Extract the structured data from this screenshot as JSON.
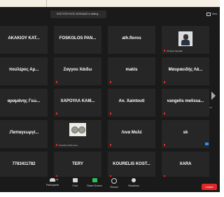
{
  "speaker": "ΚΩΣΤΟΠΟΥΛΟΣ ΛΕΩΝΙΔΑΣ is talking...",
  "view_label": "View",
  "tiles": [
    {
      "name": "ΑΚΑΚΙΟΥ ΚΑΤ...",
      "tag": ""
    },
    {
      "name": "FOSKOLOS PAN...",
      "tag": ""
    },
    {
      "name": "ath.floros",
      "tag": ""
    },
    {
      "name": "",
      "tag": "Christos Sanidas"
    },
    {
      "name": "πουλέρος Αρ...",
      "tag": ""
    },
    {
      "name": "Ζαγγου Χάιδω",
      "tag": ""
    },
    {
      "name": "makis",
      "tag": ""
    },
    {
      "name": "Μαυραειδής Λά...",
      "tag": ""
    },
    {
      "name": "αραμάνης Γεώ...",
      "tag": ""
    },
    {
      "name": "ΧΑΡΟΥΛΑ ΚΑΜ...",
      "tag": ""
    },
    {
      "name": "An. Xaintouti",
      "tag": ""
    },
    {
      "name": "vangelis melissa...",
      "tag": ""
    },
    {
      "name": ".Παπαγεωργί...",
      "tag": ""
    },
    {
      "name": "",
      "tag": "Κανελλή Χάιδω Ανα..."
    },
    {
      "name": "Λινα Μολέ",
      "tag": ""
    },
    {
      "name": "sk",
      "tag": ""
    },
    {
      "name": "7783411782",
      "tag": ""
    },
    {
      "name": "TERY",
      "tag": ""
    },
    {
      "name": "KOURELIS KOST...",
      "tag": ""
    },
    {
      "name": "XARA",
      "tag": ""
    }
  ],
  "page_indicator": "2/2",
  "toolbar": {
    "participants_label": "Participants",
    "participants_count": "35",
    "chat_label": "Chat",
    "share_label": "Share Screen",
    "record_label": "Record",
    "reactions_label": "Reactions",
    "leave_label": "Leave"
  }
}
